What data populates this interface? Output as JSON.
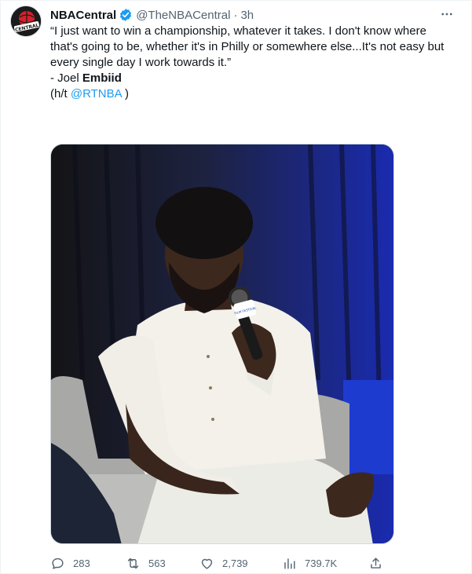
{
  "tweet": {
    "display_name": "NBACentral",
    "verified_icon": "verified-badge-icon",
    "handle": "@TheNBACentral",
    "separator": "·",
    "time": "3h",
    "avatar_text": "CENTRAL",
    "quote": "“I just want to win a championship, whatever it takes. I don't know where that's going to be, whether it's in Philly or somewhere else...It's not easy but every single day I work towards it.”",
    "signature_prefix": "- Joel ",
    "signature_name": "Embiid",
    "hat_tip_prefix": "(h/t ",
    "hat_tip_mention": "@RTNBA",
    "hat_tip_suffix": " )",
    "mic_label": "FILM FESTIVAL"
  },
  "actions": {
    "replies": "283",
    "retweets": "563",
    "likes": "2,739",
    "views": "739.7K"
  },
  "colors": {
    "accent": "#1d9bf0",
    "secondary_text": "#536471",
    "primary_text": "#0f1419"
  }
}
